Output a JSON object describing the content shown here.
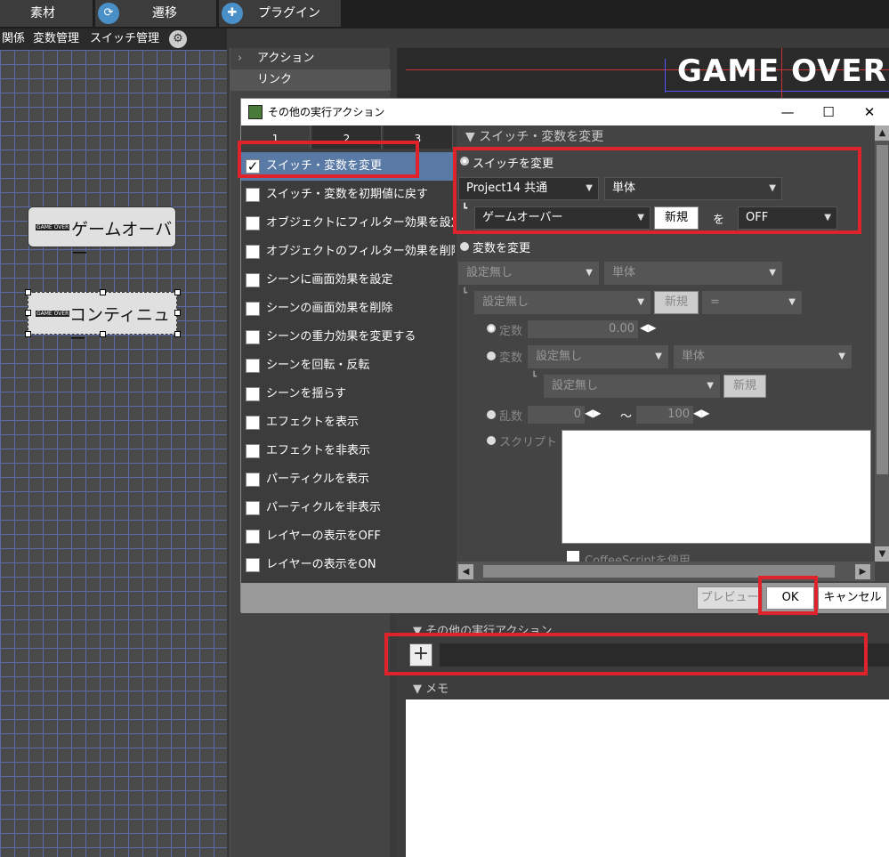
{
  "topbar": {
    "tab_material": "素材",
    "tab_transition": "遷移",
    "tab_plugin": "プラグイン"
  },
  "subbar": {
    "relation": "関係",
    "variable_mgmt": "変数管理",
    "switch_mgmt": "スイッチ管理"
  },
  "canvas": {
    "btn1_mini": "GAME OVER",
    "btn1_label": "ゲームオーバー",
    "btn2_mini": "GAME OVER",
    "btn2_label": "コンティニュー"
  },
  "midpanel": {
    "action": "アクション",
    "link": "リンク"
  },
  "preview": {
    "title": "GAME OVER"
  },
  "dialog": {
    "title": "その他の実行アクション",
    "tabs": [
      "1",
      "2",
      "3"
    ],
    "list": [
      {
        "label": "スイッチ・変数を変更",
        "checked": true
      },
      {
        "label": "スイッチ・変数を初期値に戻す"
      },
      {
        "label": "オブジェクトにフィルター効果を設定"
      },
      {
        "label": "オブジェクトのフィルター効果を削除"
      },
      {
        "label": "シーンに画面効果を設定"
      },
      {
        "label": "シーンの画面効果を削除"
      },
      {
        "label": "シーンの重力効果を変更する"
      },
      {
        "label": "シーンを回転・反転"
      },
      {
        "label": "シーンを揺らす"
      },
      {
        "label": "エフェクトを表示"
      },
      {
        "label": "エフェクトを非表示"
      },
      {
        "label": "パーティクルを表示"
      },
      {
        "label": "パーティクルを非表示"
      },
      {
        "label": "レイヤーの表示をOFF"
      },
      {
        "label": "レイヤーの表示をON"
      }
    ],
    "section_title": "スイッチ・変数を変更",
    "switch_change": "スイッチを変更",
    "switch_scope": "Project14 共通",
    "switch_unit": "単体",
    "switch_name": "ゲームオーバー",
    "new_label": "新規",
    "wo": "を",
    "switch_value": "OFF",
    "var_change": "変数を変更",
    "var_scope": "設定無し",
    "var_unit": "単体",
    "var_name": "設定無し",
    "var_new": "新規",
    "var_op": "=",
    "const_label": "定数",
    "const_value": "0.00",
    "var_label": "変数",
    "var2_scope": "設定無し",
    "var2_unit": "単体",
    "var2_name": "設定無し",
    "var2_new": "新規",
    "rand_label": "乱数",
    "rand_min": "0",
    "rand_tilde": "〜",
    "rand_max": "100",
    "script_label": "スクリプト",
    "coffee_label": "CoffeeScriptを使用",
    "preview_btn": "プレビュー",
    "ok_btn": "OK",
    "cancel_btn": "キャンセル"
  },
  "lower": {
    "other_actions": "その他の実行アクション",
    "memo": "メモ"
  }
}
